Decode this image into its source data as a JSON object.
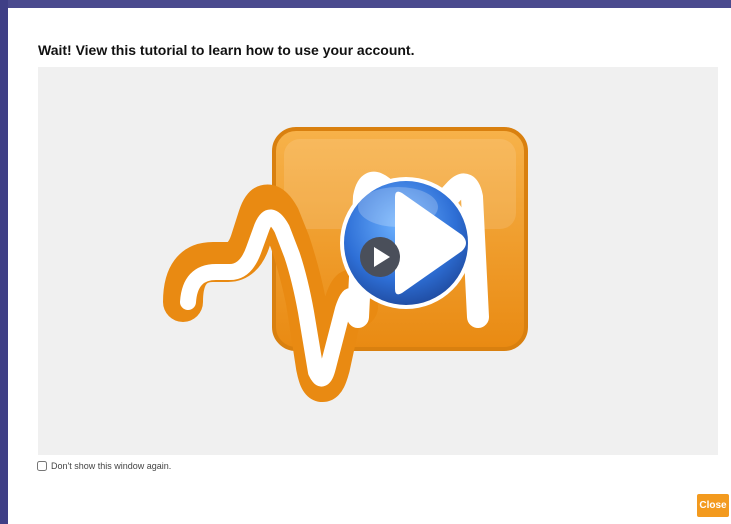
{
  "dialog": {
    "title": "Wait! View this tutorial to learn how to use your account.",
    "dont_show_label": "Don't show this window again.",
    "dont_show_checked": false,
    "close_label": "Close"
  },
  "video": {
    "logo_icon": "orange-waveform-logo-icon",
    "play_icon": "blue-play-button-icon"
  },
  "colors": {
    "accent_orange": "#f39a1e",
    "play_blue": "#2e6fd6",
    "frame_border": "#3f3f86",
    "panel_background": "#f0f0f0"
  }
}
